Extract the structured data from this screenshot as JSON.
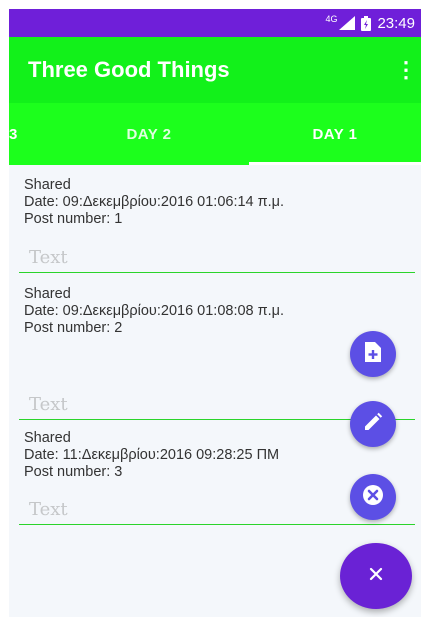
{
  "status_bar": {
    "network": "4G",
    "time": "23:49"
  },
  "app_bar": {
    "title": "Three Good Things",
    "overflow_icon": "⋮"
  },
  "tabs": [
    {
      "label": "3"
    },
    {
      "label": "DAY 2"
    },
    {
      "label": "DAY 1",
      "selected": true
    }
  ],
  "posts": [
    {
      "status": "Shared",
      "date": "Date: 09:Δεκεμβρίου:2016 01:06:14 π.μ.",
      "post_number": "Post number: 1",
      "text_placeholder": "Text"
    },
    {
      "status": "Shared",
      "date": "Date: 09:Δεκεμβρίου:2016 01:08:08 π.μ.",
      "post_number": "Post number: 2",
      "text_placeholder": "Text"
    },
    {
      "status": "Shared",
      "date": "Date: 11:Δεκεμβρίου:2016 09:28:25 ΠΜ",
      "post_number": "Post number: 3",
      "text_placeholder": "Text"
    }
  ],
  "fabs": {
    "main_icon": "×",
    "icons": [
      "note-add-icon",
      "edit-icon",
      "cancel-icon",
      "close-icon"
    ]
  },
  "colors": {
    "status_bar": "#6F1FD9",
    "app_bar": "#12F11A",
    "tab_bar": "#1CFF1C",
    "fab_small": "#5C4FE5",
    "fab_main": "#6A22D5",
    "field_underline": "#2BD42B"
  }
}
